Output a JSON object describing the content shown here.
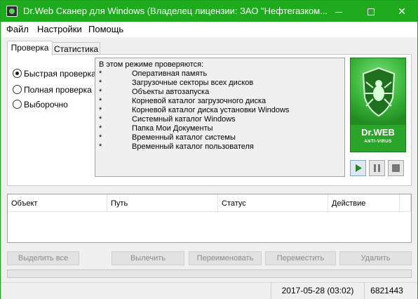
{
  "window": {
    "title": "Dr.Web Сканер для Windows (Владелец лицензии: ЗАО \"Нефтегазком...",
    "accent_color": "#1eab1e"
  },
  "menu": [
    "Файл",
    "Настройки",
    "Помощь"
  ],
  "tabs": [
    "Проверка",
    "Статистика"
  ],
  "scan_modes": [
    {
      "label": "Быстрая проверка",
      "selected": true
    },
    {
      "label": "Полная проверка",
      "selected": false
    },
    {
      "label": "Выборочно",
      "selected": false
    }
  ],
  "info": {
    "header": "В этом режиме проверяются:",
    "bullet": "*",
    "items": [
      "Оперативная память",
      "Загрузочные секторы всех дисков",
      "Объекты автозапуска",
      "Корневой каталог загрузочного диска",
      "Корневой каталог диска установки Windows",
      "Системный каталог Windows",
      "Папка Мои Документы",
      "Временный каталог системы",
      "Временный каталог пользователя"
    ]
  },
  "logo": {
    "brand": "Dr.WEB",
    "sub": "ANTI-VIRUS"
  },
  "controls": {
    "play_icon": "play-icon",
    "pause_icon": "pause-icon",
    "stop_icon": "stop-icon"
  },
  "columns": [
    "Объект",
    "Путь",
    "Статус",
    "Действие"
  ],
  "actions": [
    "Выделить все",
    "Вылечить",
    "Переименовать",
    "Переместить",
    "Удалить"
  ],
  "status": {
    "date": "2017-05-28 (03:02)",
    "count": "6821443"
  }
}
